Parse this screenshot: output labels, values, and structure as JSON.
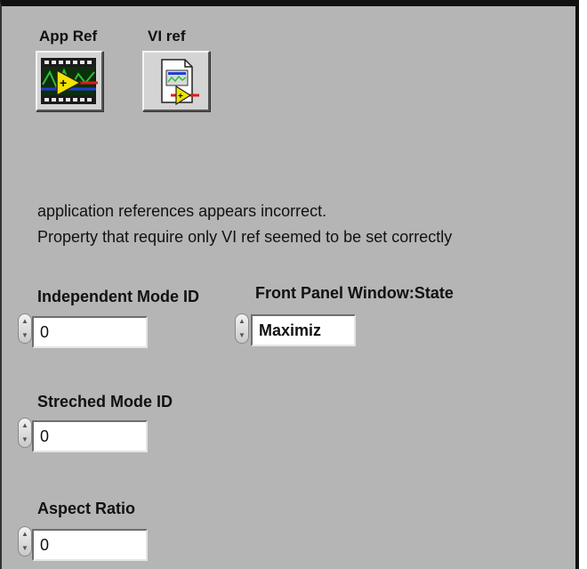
{
  "refs": {
    "app_ref_label": "App Ref",
    "vi_ref_label": "VI ref"
  },
  "message": {
    "line1": "application references appears incorrect.",
    "line2": "Property that require only VI ref seemed to be set correctly"
  },
  "controls": {
    "independent_mode": {
      "label": "Independent Mode ID",
      "value": "0"
    },
    "front_panel_state": {
      "label": "Front Panel Window:State",
      "value": "Maximiz"
    },
    "stretched_mode": {
      "label": "Streched Mode ID",
      "value": "0"
    },
    "aspect_ratio": {
      "label": "Aspect Ratio",
      "value": "0"
    }
  },
  "colors": {
    "panel_background": "#b5b5b5",
    "field_background": "#ffffff",
    "icon_yellow": "#f2e300",
    "icon_green": "#2fbf3a",
    "icon_red": "#e11c1c",
    "icon_blue": "#1f3fd6"
  },
  "icons": {
    "app_ref": "application-reference-icon",
    "vi_ref": "vi-reference-icon",
    "spinner": "increment-decrement-arrows"
  }
}
